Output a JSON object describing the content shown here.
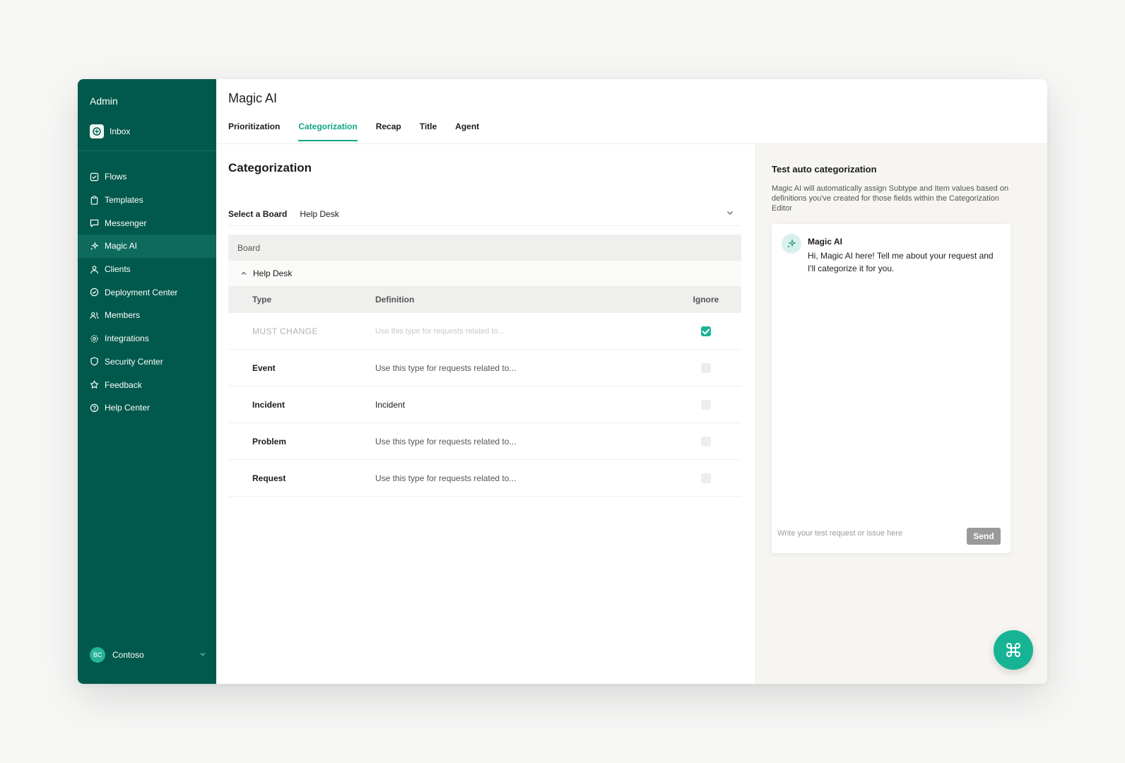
{
  "sidebar": {
    "title": "Admin",
    "inbox_label": "Inbox",
    "items": [
      {
        "label": "Flows",
        "icon": "checklist-icon"
      },
      {
        "label": "Templates",
        "icon": "clipboard-icon"
      },
      {
        "label": "Messenger",
        "icon": "chat-bubble-icon"
      },
      {
        "label": "Magic AI",
        "icon": "sparkles-icon",
        "active": true
      },
      {
        "label": "Clients",
        "icon": "person-icon"
      },
      {
        "label": "Deployment Center",
        "icon": "check-circle-icon"
      },
      {
        "label": "Members",
        "icon": "people-icon"
      },
      {
        "label": "Integrations",
        "icon": "gear-icon"
      },
      {
        "label": "Security Center",
        "icon": "shield-icon"
      },
      {
        "label": "Feedback",
        "icon": "star-icon"
      },
      {
        "label": "Help Center",
        "icon": "question-circle-icon"
      }
    ],
    "org": {
      "initials": "BC",
      "name": "Contoso"
    }
  },
  "header": {
    "title": "Magic AI",
    "tabs": [
      {
        "label": "Prioritization",
        "active": false
      },
      {
        "label": "Categorization",
        "active": true
      },
      {
        "label": "Recap",
        "active": false
      },
      {
        "label": "Title",
        "active": false
      },
      {
        "label": "Agent",
        "active": false
      }
    ]
  },
  "categorization": {
    "title": "Categorization",
    "select_board_label": "Select a Board",
    "selected_board": "Help Desk",
    "table": {
      "board_header": "Board",
      "group": "Help Desk",
      "columns": {
        "type": "Type",
        "definition": "Definition",
        "ignore": "Ignore"
      },
      "rows": [
        {
          "type": "MUST CHANGE",
          "definition": "Use this type for requests related to...",
          "ignored": true,
          "muted": true
        },
        {
          "type": "Event",
          "definition": "Use this type for requests related to...",
          "ignored": false
        },
        {
          "type": "Incident",
          "definition": "Incident",
          "ignored": false,
          "filled": true
        },
        {
          "type": "Problem",
          "definition": "Use this type for requests related to...",
          "ignored": false
        },
        {
          "type": "Request",
          "definition": "Use this type for requests related to...",
          "ignored": false
        }
      ]
    }
  },
  "test_panel": {
    "title": "Test auto categorization",
    "description": "Magic AI will automatically assign Subtype and Item values based on definitions you've created for those fields within the Categorization Editor",
    "bot_name": "Magic AI",
    "bot_message": "Hi, Magic AI here! Tell me about your request and I'll categorize it for you.",
    "input_placeholder": "Write your test request or issue here",
    "send_label": "Send"
  },
  "colors": {
    "sidebar_bg": "#00594c",
    "accent": "#0fa68a",
    "fab": "#16b494"
  }
}
